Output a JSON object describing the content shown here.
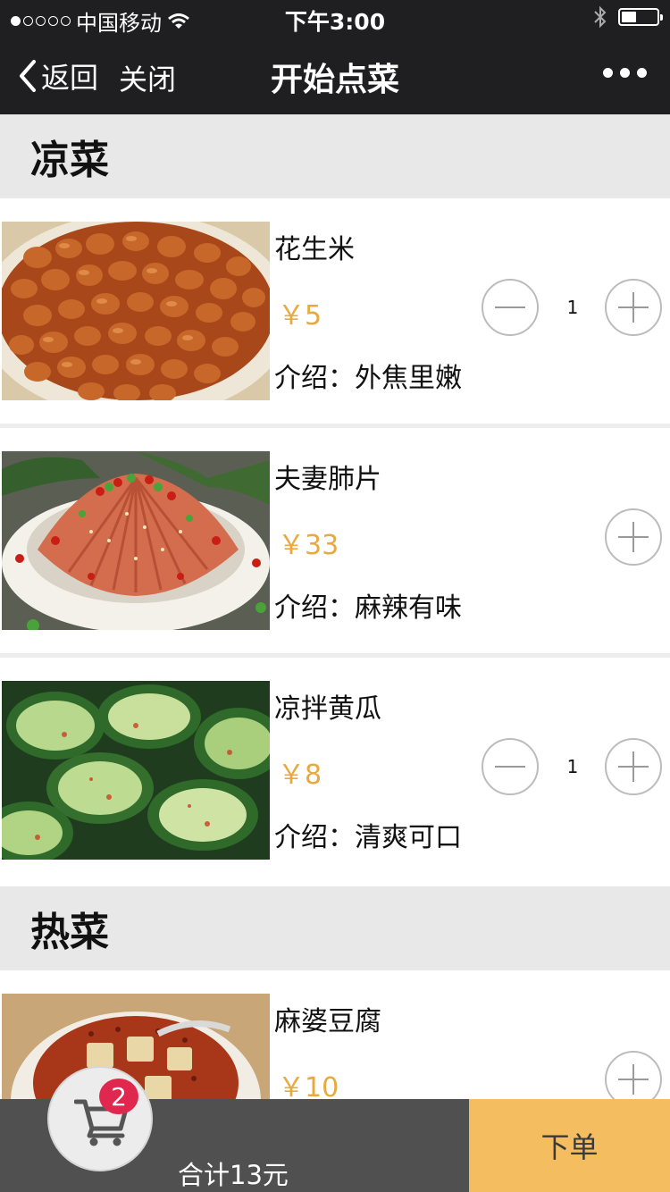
{
  "status_bar": {
    "carrier": "中国移动",
    "time": "下午3:00",
    "signal_icon": "signal-dots-icon",
    "wifi_icon": "wifi-icon",
    "bluetooth_icon": "bluetooth-icon",
    "battery_icon": "battery-icon"
  },
  "nav": {
    "back_label": "返回",
    "close_label": "关闭",
    "title": "开始点菜",
    "more_icon": "more-dots-icon"
  },
  "categories": [
    {
      "name": "凉菜",
      "dishes": [
        {
          "name": "花生米",
          "price": "￥5",
          "desc": "介绍：外焦里嫩",
          "qty": "1",
          "image": "peanuts-photo"
        },
        {
          "name": "夫妻肺片",
          "price": "￥33",
          "desc": "介绍：麻辣有味",
          "qty": "",
          "image": "fuqi-feipian-photo"
        },
        {
          "name": "凉拌黄瓜",
          "price": "￥8",
          "desc": "介绍：清爽可口",
          "qty": "1",
          "image": "cucumber-salad-photo"
        }
      ]
    },
    {
      "name": "热菜",
      "dishes": [
        {
          "name": "麻婆豆腐",
          "price": "￥10",
          "desc": "",
          "qty": "",
          "image": "mapo-tofu-photo"
        }
      ]
    }
  ],
  "cart": {
    "badge_count": "2",
    "icon": "cart-icon",
    "total": "合计13元",
    "order_label": "下单"
  },
  "colors": {
    "bar_dark": "#1f1f21",
    "price": "#e8a93e",
    "order_button": "#f3bd60",
    "bottom_bar": "#505050",
    "badge": "#e0284f",
    "category_bg": "#e8e8e8"
  }
}
